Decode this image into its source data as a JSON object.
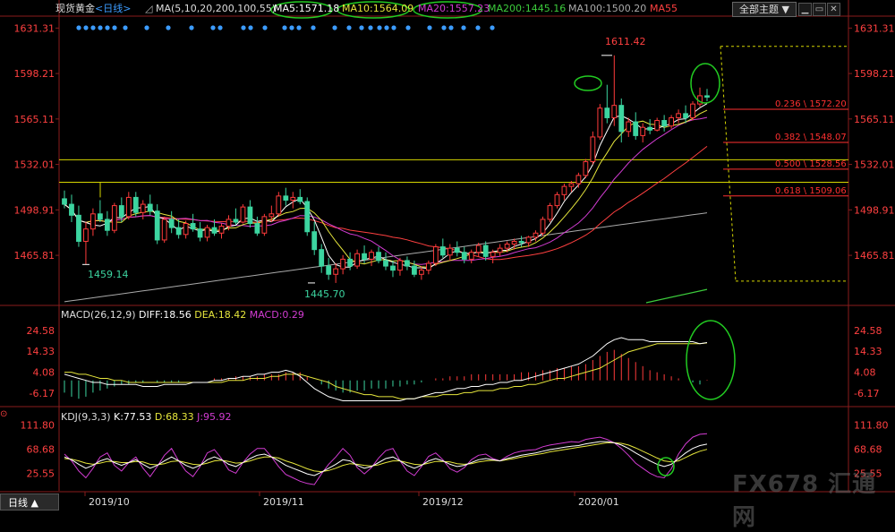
{
  "header": {
    "instrument": "现货黄金",
    "period": "<日线>",
    "ma_params": "MA(5,10,20,200,100,55)",
    "ma5": "MA5:1571.18",
    "ma10": "MA10:1564.09",
    "ma20": "MA20:1557.23",
    "ma200": "MA200:1445.16",
    "ma100": "MA100:1500.20",
    "ma55": "MA55",
    "theme_button": "全部主题"
  },
  "colors": {
    "up": "#ff3b3b",
    "down": "#3cd5a0",
    "ma5": "#ffffff",
    "ma10": "#e6e63c",
    "ma20": "#d23cd2",
    "ma200": "#3ccc3c",
    "ma100": "#aaaaaa",
    "ma55": "#ff4040",
    "fib": "#ff3030",
    "level": "#d6d600",
    "annotation": "#22cc22",
    "axis_text": "#ff4040"
  },
  "chart_data": [
    {
      "type": "candlestick",
      "title": "现货黄金 <日线>",
      "x_ticks": [
        "2019/10",
        "2019/11",
        "2019/12",
        "2020/01"
      ],
      "y_ticks": [
        1631.31,
        1598.21,
        1565.11,
        1532.01,
        1498.91,
        1465.81
      ],
      "ylim": [
        1430,
        1640
      ],
      "grid": false,
      "annotations": {
        "high_label": "1611.42",
        "low_label_1": "1459.14",
        "low_label_2": "1445.70"
      },
      "fibonacci": [
        {
          "label": "0.236 \\ 1572.20",
          "value": 1572.2
        },
        {
          "label": "0.382 \\ 1548.07",
          "value": 1548.07
        },
        {
          "label": "0.500 \\ 1528.56",
          "value": 1528.56
        },
        {
          "label": "0.618 \\ 1509.06",
          "value": 1509.06
        }
      ],
      "horizontal_levels": [
        1535.4,
        1519.0
      ],
      "candles": [
        [
          1507,
          1513,
          1500,
          1503
        ],
        [
          1503,
          1510,
          1490,
          1495
        ],
        [
          1495,
          1502,
          1472,
          1476
        ],
        [
          1476,
          1490,
          1459.14,
          1485
        ],
        [
          1485,
          1500,
          1480,
          1496
        ],
        [
          1496,
          1506,
          1490,
          1492
        ],
        [
          1492,
          1498,
          1480,
          1484
        ],
        [
          1484,
          1504,
          1482,
          1502
        ],
        [
          1502,
          1508,
          1490,
          1494
        ],
        [
          1494,
          1512,
          1492,
          1508
        ],
        [
          1508,
          1512,
          1494,
          1497
        ],
        [
          1497,
          1506,
          1492,
          1503
        ],
        [
          1503,
          1510,
          1495,
          1498
        ],
        [
          1498,
          1503,
          1474,
          1477
        ],
        [
          1477,
          1494,
          1475,
          1492
        ],
        [
          1492,
          1498,
          1482,
          1486
        ],
        [
          1486,
          1492,
          1478,
          1481
        ],
        [
          1481,
          1491,
          1478,
          1489
        ],
        [
          1489,
          1496,
          1483,
          1485
        ],
        [
          1485,
          1490,
          1476,
          1479
        ],
        [
          1479,
          1488,
          1476,
          1486
        ],
        [
          1486,
          1492,
          1480,
          1482
        ],
        [
          1482,
          1489,
          1478,
          1487
        ],
        [
          1487,
          1495,
          1484,
          1492
        ],
        [
          1492,
          1500,
          1488,
          1490
        ],
        [
          1490,
          1503,
          1489,
          1501
        ],
        [
          1501,
          1506,
          1486,
          1489
        ],
        [
          1489,
          1494,
          1480,
          1482
        ],
        [
          1482,
          1496,
          1480,
          1494
        ],
        [
          1494,
          1502,
          1490,
          1496
        ],
        [
          1496,
          1512,
          1494,
          1509
        ],
        [
          1509,
          1515,
          1502,
          1506
        ],
        [
          1506,
          1512,
          1500,
          1508
        ],
        [
          1508,
          1514,
          1503,
          1505
        ],
        [
          1505,
          1508,
          1480,
          1483
        ],
        [
          1483,
          1490,
          1466,
          1470
        ],
        [
          1470,
          1474,
          1453,
          1458
        ],
        [
          1458,
          1464,
          1448,
          1452
        ],
        [
          1452,
          1460,
          1445.7,
          1456
        ],
        [
          1456,
          1466,
          1452,
          1463
        ],
        [
          1463,
          1468,
          1455,
          1458
        ],
        [
          1458,
          1470,
          1456,
          1467
        ],
        [
          1467,
          1473,
          1460,
          1463
        ],
        [
          1463,
          1470,
          1458,
          1468
        ],
        [
          1468,
          1472,
          1460,
          1462
        ],
        [
          1462,
          1468,
          1455,
          1458
        ],
        [
          1458,
          1462,
          1450,
          1455
        ],
        [
          1455,
          1464,
          1451,
          1462
        ],
        [
          1462,
          1465,
          1455,
          1458
        ],
        [
          1458,
          1462,
          1450,
          1452
        ],
        [
          1452,
          1458,
          1448,
          1455
        ],
        [
          1455,
          1462,
          1452,
          1460
        ],
        [
          1460,
          1474,
          1458,
          1472
        ],
        [
          1472,
          1478,
          1464,
          1466
        ],
        [
          1466,
          1474,
          1462,
          1471
        ],
        [
          1471,
          1476,
          1465,
          1468
        ],
        [
          1468,
          1472,
          1460,
          1463
        ],
        [
          1463,
          1470,
          1460,
          1468
        ],
        [
          1468,
          1475,
          1465,
          1473
        ],
        [
          1473,
          1476,
          1462,
          1465
        ],
        [
          1465,
          1470,
          1460,
          1468
        ],
        [
          1468,
          1474,
          1465,
          1471
        ],
        [
          1471,
          1476,
          1468,
          1474
        ],
        [
          1474,
          1478,
          1470,
          1476
        ],
        [
          1476,
          1480,
          1472,
          1475
        ],
        [
          1475,
          1480,
          1472,
          1479
        ],
        [
          1479,
          1484,
          1476,
          1482
        ],
        [
          1482,
          1494,
          1480,
          1492
        ],
        [
          1492,
          1504,
          1490,
          1502
        ],
        [
          1502,
          1512,
          1500,
          1510
        ],
        [
          1510,
          1518,
          1506,
          1516
        ],
        [
          1516,
          1520,
          1512,
          1518
        ],
        [
          1518,
          1526,
          1515,
          1524
        ],
        [
          1524,
          1536,
          1522,
          1534
        ],
        [
          1534,
          1556,
          1532,
          1552
        ],
        [
          1552,
          1576,
          1550,
          1573
        ],
        [
          1573,
          1590,
          1562,
          1566
        ],
        [
          1566,
          1611.42,
          1560,
          1575
        ],
        [
          1575,
          1580,
          1548,
          1556
        ],
        [
          1556,
          1566,
          1552,
          1563
        ],
        [
          1563,
          1570,
          1550,
          1553
        ],
        [
          1553,
          1562,
          1548,
          1559
        ],
        [
          1559,
          1565,
          1554,
          1557
        ],
        [
          1557,
          1566,
          1556,
          1564
        ],
        [
          1564,
          1568,
          1556,
          1560
        ],
        [
          1560,
          1568,
          1558,
          1566
        ],
        [
          1566,
          1572,
          1562,
          1569
        ],
        [
          1569,
          1575,
          1562,
          1566
        ],
        [
          1566,
          1578,
          1564,
          1576
        ],
        [
          1576,
          1588,
          1574,
          1582
        ],
        [
          1582,
          1587,
          1578,
          1581
        ]
      ]
    },
    {
      "type": "macd",
      "label": "MACD(26,12,9)",
      "diff": "DIFF:18.56",
      "dea": "DEA:18.42",
      "macd": "MACD:0.29",
      "y_ticks": [
        24.58,
        14.33,
        4.08,
        -6.17
      ],
      "ylim": [
        -12,
        32
      ],
      "hist": [
        -6,
        -8,
        -9,
        -8,
        -6,
        -5,
        -4,
        -3,
        -2,
        -2,
        -1,
        -1,
        0,
        -1,
        -1,
        -1,
        -1,
        0,
        0,
        0,
        0,
        1,
        1,
        1,
        2,
        2,
        2,
        2,
        3,
        3,
        3,
        4,
        4,
        4,
        2,
        0,
        -2,
        -4,
        -5,
        -6,
        -6,
        -5,
        -5,
        -4,
        -4,
        -4,
        -3,
        -3,
        -2,
        -2,
        -1,
        0,
        1,
        1,
        2,
        2,
        2,
        3,
        3,
        3,
        3,
        3,
        3,
        3,
        4,
        4,
        4,
        5,
        5,
        6,
        6,
        7,
        7,
        8,
        10,
        12,
        14,
        15,
        13,
        11,
        9,
        7,
        5,
        4,
        3,
        2,
        1,
        0,
        -1,
        -2,
        0.29
      ],
      "diff_series": [
        3,
        2,
        1,
        0,
        -1,
        -1,
        -2,
        -2,
        -2,
        -2,
        -2,
        -3,
        -3,
        -3,
        -2,
        -2,
        -2,
        -2,
        -1,
        -1,
        -1,
        0,
        0,
        1,
        1,
        2,
        2,
        3,
        3,
        4,
        4,
        5,
        4,
        2,
        -1,
        -4,
        -6,
        -8,
        -9,
        -10,
        -10,
        -10,
        -10,
        -10,
        -10,
        -10,
        -10,
        -10,
        -9,
        -9,
        -8,
        -7,
        -6,
        -6,
        -5,
        -4,
        -4,
        -3,
        -3,
        -2,
        -2,
        -1,
        -1,
        0,
        0,
        1,
        2,
        3,
        4,
        5,
        6,
        7,
        8,
        10,
        12,
        15,
        18,
        20,
        21,
        20,
        20,
        20,
        19,
        19,
        19,
        19,
        19,
        19,
        19,
        18,
        18.56
      ],
      "dea_series": [
        4,
        4,
        3,
        3,
        2,
        1,
        1,
        0,
        0,
        -1,
        -1,
        -1,
        -1,
        -1,
        -1,
        -1,
        -1,
        -1,
        -1,
        -1,
        -1,
        -1,
        -1,
        0,
        0,
        0,
        1,
        1,
        1,
        2,
        2,
        3,
        3,
        3,
        2,
        1,
        0,
        -1,
        -3,
        -4,
        -5,
        -6,
        -7,
        -7,
        -8,
        -8,
        -8,
        -9,
        -9,
        -9,
        -8,
        -8,
        -8,
        -7,
        -7,
        -7,
        -6,
        -6,
        -5,
        -5,
        -5,
        -4,
        -4,
        -3,
        -3,
        -2,
        -2,
        -1,
        0,
        1,
        1,
        2,
        3,
        4,
        5,
        6,
        8,
        10,
        12,
        14,
        15,
        16,
        17,
        18,
        18,
        18,
        18,
        18,
        18,
        18,
        18.42
      ]
    },
    {
      "type": "kdj",
      "label": "KDJ(9,3,3)",
      "k": "K:77.53",
      "d": "D:68.33",
      "j": "J:95.92",
      "y_ticks": [
        111.8,
        68.68,
        25.55
      ],
      "ylim": [
        -5,
        125
      ],
      "k_series": [
        55,
        50,
        42,
        35,
        40,
        48,
        52,
        45,
        40,
        45,
        50,
        42,
        35,
        40,
        48,
        55,
        48,
        40,
        35,
        40,
        50,
        55,
        50,
        42,
        38,
        45,
        52,
        58,
        60,
        55,
        48,
        40,
        35,
        30,
        25,
        22,
        28,
        35,
        42,
        50,
        48,
        40,
        35,
        38,
        45,
        52,
        55,
        48,
        40,
        35,
        40,
        48,
        52,
        48,
        42,
        38,
        40,
        45,
        50,
        52,
        50,
        48,
        52,
        55,
        58,
        60,
        62,
        65,
        68,
        70,
        72,
        74,
        75,
        78,
        80,
        82,
        82,
        80,
        76,
        70,
        62,
        55,
        48,
        42,
        38,
        42,
        52,
        62,
        70,
        75,
        77.53
      ],
      "d_series": [
        52,
        51,
        48,
        44,
        42,
        44,
        47,
        47,
        45,
        45,
        47,
        46,
        42,
        41,
        43,
        47,
        48,
        45,
        42,
        41,
        44,
        48,
        49,
        47,
        44,
        45,
        48,
        52,
        55,
        55,
        53,
        48,
        44,
        39,
        34,
        30,
        29,
        31,
        35,
        40,
        43,
        42,
        40,
        39,
        41,
        45,
        48,
        48,
        45,
        42,
        41,
        44,
        47,
        47,
        46,
        43,
        42,
        43,
        46,
        48,
        49,
        48,
        50,
        52,
        55,
        57,
        59,
        61,
        64,
        66,
        68,
        70,
        72,
        74,
        76,
        78,
        80,
        80,
        79,
        76,
        71,
        65,
        59,
        53,
        48,
        46,
        48,
        54,
        60,
        65,
        68.33
      ],
      "j_series": [
        60,
        48,
        30,
        18,
        35,
        55,
        62,
        40,
        30,
        45,
        55,
        35,
        20,
        38,
        58,
        70,
        48,
        30,
        20,
        38,
        62,
        68,
        52,
        32,
        26,
        45,
        60,
        70,
        70,
        55,
        38,
        24,
        18,
        12,
        8,
        6,
        25,
        42,
        55,
        70,
        58,
        36,
        25,
        36,
        53,
        66,
        70,
        48,
        30,
        22,
        38,
        56,
        62,
        50,
        34,
        28,
        36,
        50,
        58,
        60,
        52,
        48,
        56,
        62,
        65,
        67,
        68,
        73,
        76,
        78,
        80,
        82,
        81,
        86,
        88,
        90,
        86,
        80,
        70,
        58,
        44,
        35,
        26,
        20,
        18,
        34,
        60,
        78,
        90,
        95,
        95.92
      ]
    }
  ],
  "x_axis_tab": "日线",
  "watermark": "FX678 汇通网"
}
